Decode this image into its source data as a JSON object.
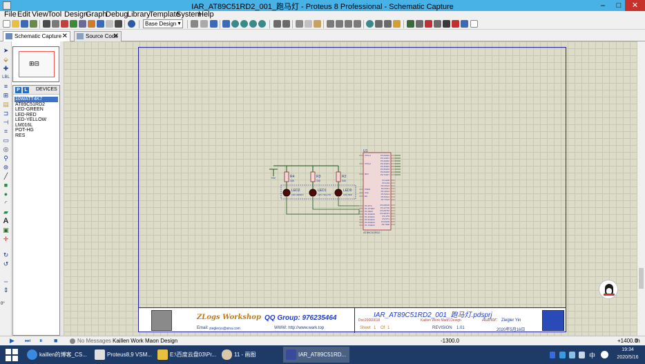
{
  "window": {
    "title": "IAR_AT89C51RD2_001_跑马灯 - Proteus 8 Professional - Schematic Capture",
    "minimize": "–",
    "maximize": "□",
    "close": "✕"
  },
  "menu": [
    "File",
    "Edit",
    "View",
    "Tool",
    "Design",
    "Graph",
    "Debug",
    "Library",
    "Template",
    "System",
    "Help"
  ],
  "toolbar": {
    "design_select": "Base Design"
  },
  "tabs": [
    {
      "label": "Schematic Capture",
      "close": "✕",
      "active": true
    },
    {
      "label": "Source Code",
      "close": "✕",
      "active": false
    }
  ],
  "left_tools": {
    "rotation": "0°"
  },
  "devices": {
    "p_button": "P",
    "l_button": "L",
    "title": "DEVICES",
    "items": [
      "10WATT4K7",
      "AT89C51RD2",
      "LED-GREEN",
      "LED-RED",
      "LED-YELLOW",
      "LM016L",
      "POT-HG",
      "RES"
    ],
    "selected_index": 0
  },
  "schematic": {
    "u1_ref": "U1",
    "u1_part": "AT89C51RD2",
    "u1_pins_left": [
      "XTAL1",
      "XTAL2",
      "RST",
      "PSEN",
      "ALE",
      "EA",
      "P1.0/T2",
      "P1.1/T2EX",
      "P1.2/ECI",
      "P1.3/CEX0",
      "P1.4/CEX1",
      "P1.5/CEX2",
      "P1.6/CEX3",
      "P1.7/CEX4"
    ],
    "u1_pins_right": [
      "P0.0/AD0",
      "P0.1/AD1",
      "P0.2/AD2",
      "P0.3/AD3",
      "P0.4/AD4",
      "P0.5/AD5",
      "P0.6/AD6",
      "P0.7/AD7",
      "P2.0/A8",
      "P2.1/A9",
      "P2.2/A10",
      "P2.3/A11",
      "P2.4/A12",
      "P2.5/A13",
      "P2.6/A14",
      "P2.7/A15",
      "P3.0/RXD",
      "P3.1/TXD",
      "P3.2/INT0",
      "P3.3/INT1",
      "P3.4/T0",
      "P3.5/T1",
      "P3.6/WR",
      "P3.7/RD"
    ],
    "resistors": [
      {
        "ref": "R4",
        "value": "330"
      },
      {
        "ref": "R3",
        "value": "330"
      },
      {
        "ref": "R2",
        "value": "330"
      }
    ],
    "leds": [
      {
        "ref": "LED2",
        "part": "LED-GREEN"
      },
      {
        "ref": "LED1",
        "part": "LED-YELLOW"
      },
      {
        "ref": "LED0",
        "part": "LED-RED"
      }
    ],
    "supply": "+5V"
  },
  "title_block": {
    "logo_text": "ZLogs Workshop",
    "qq_group": "QQ Group: 976235464",
    "email_label": "Email:",
    "email_value": "zieglerys@sina.com",
    "www": "WWW: http://www.wark.top",
    "project": "IAR_AT89C51RD2_001_跑马灯.pdsprj",
    "doc_no": "Doc20060018",
    "company": "Kaillen Work Maon Design",
    "author_label": "Author:",
    "author": "Ziegler Yin",
    "sheet_label": "Sheet",
    "sheet": "1",
    "of_label": "Of",
    "of": "1",
    "revision_label": "REVISION",
    "revision": "1.01",
    "date": "2020年5月16日"
  },
  "status": {
    "messages": "No Messages",
    "sheet_name": "Kaillen Work Maon Design",
    "coord_x": "-1300.0",
    "coord_y": "+1400.0",
    "unit": "th"
  },
  "taskbar": {
    "items": [
      {
        "label": "kaillen的博客_CS...",
        "active": false
      },
      {
        "label": "Proteus8,9 VSM...",
        "active": false
      },
      {
        "label": "E:\\百度云盘03\\Pr...",
        "active": false
      },
      {
        "label": "11 - 画图",
        "active": false
      },
      {
        "label": "IAR_AT89C51RD...",
        "active": true
      }
    ],
    "lang": "中",
    "time": "19:34",
    "date": "2020/5/16"
  },
  "colors": {
    "titlebar": "#48b2e6",
    "canvas": "#dcdcc8",
    "sheet_border": "#2020a0",
    "wire": "#1e5a1e",
    "ic_body": "#f0d8d8",
    "ic_border": "#8a2a2a",
    "pin_blue": "#1c3c8c",
    "title_blue": "#1e3ac8",
    "taskbar": "#1e3a66"
  }
}
